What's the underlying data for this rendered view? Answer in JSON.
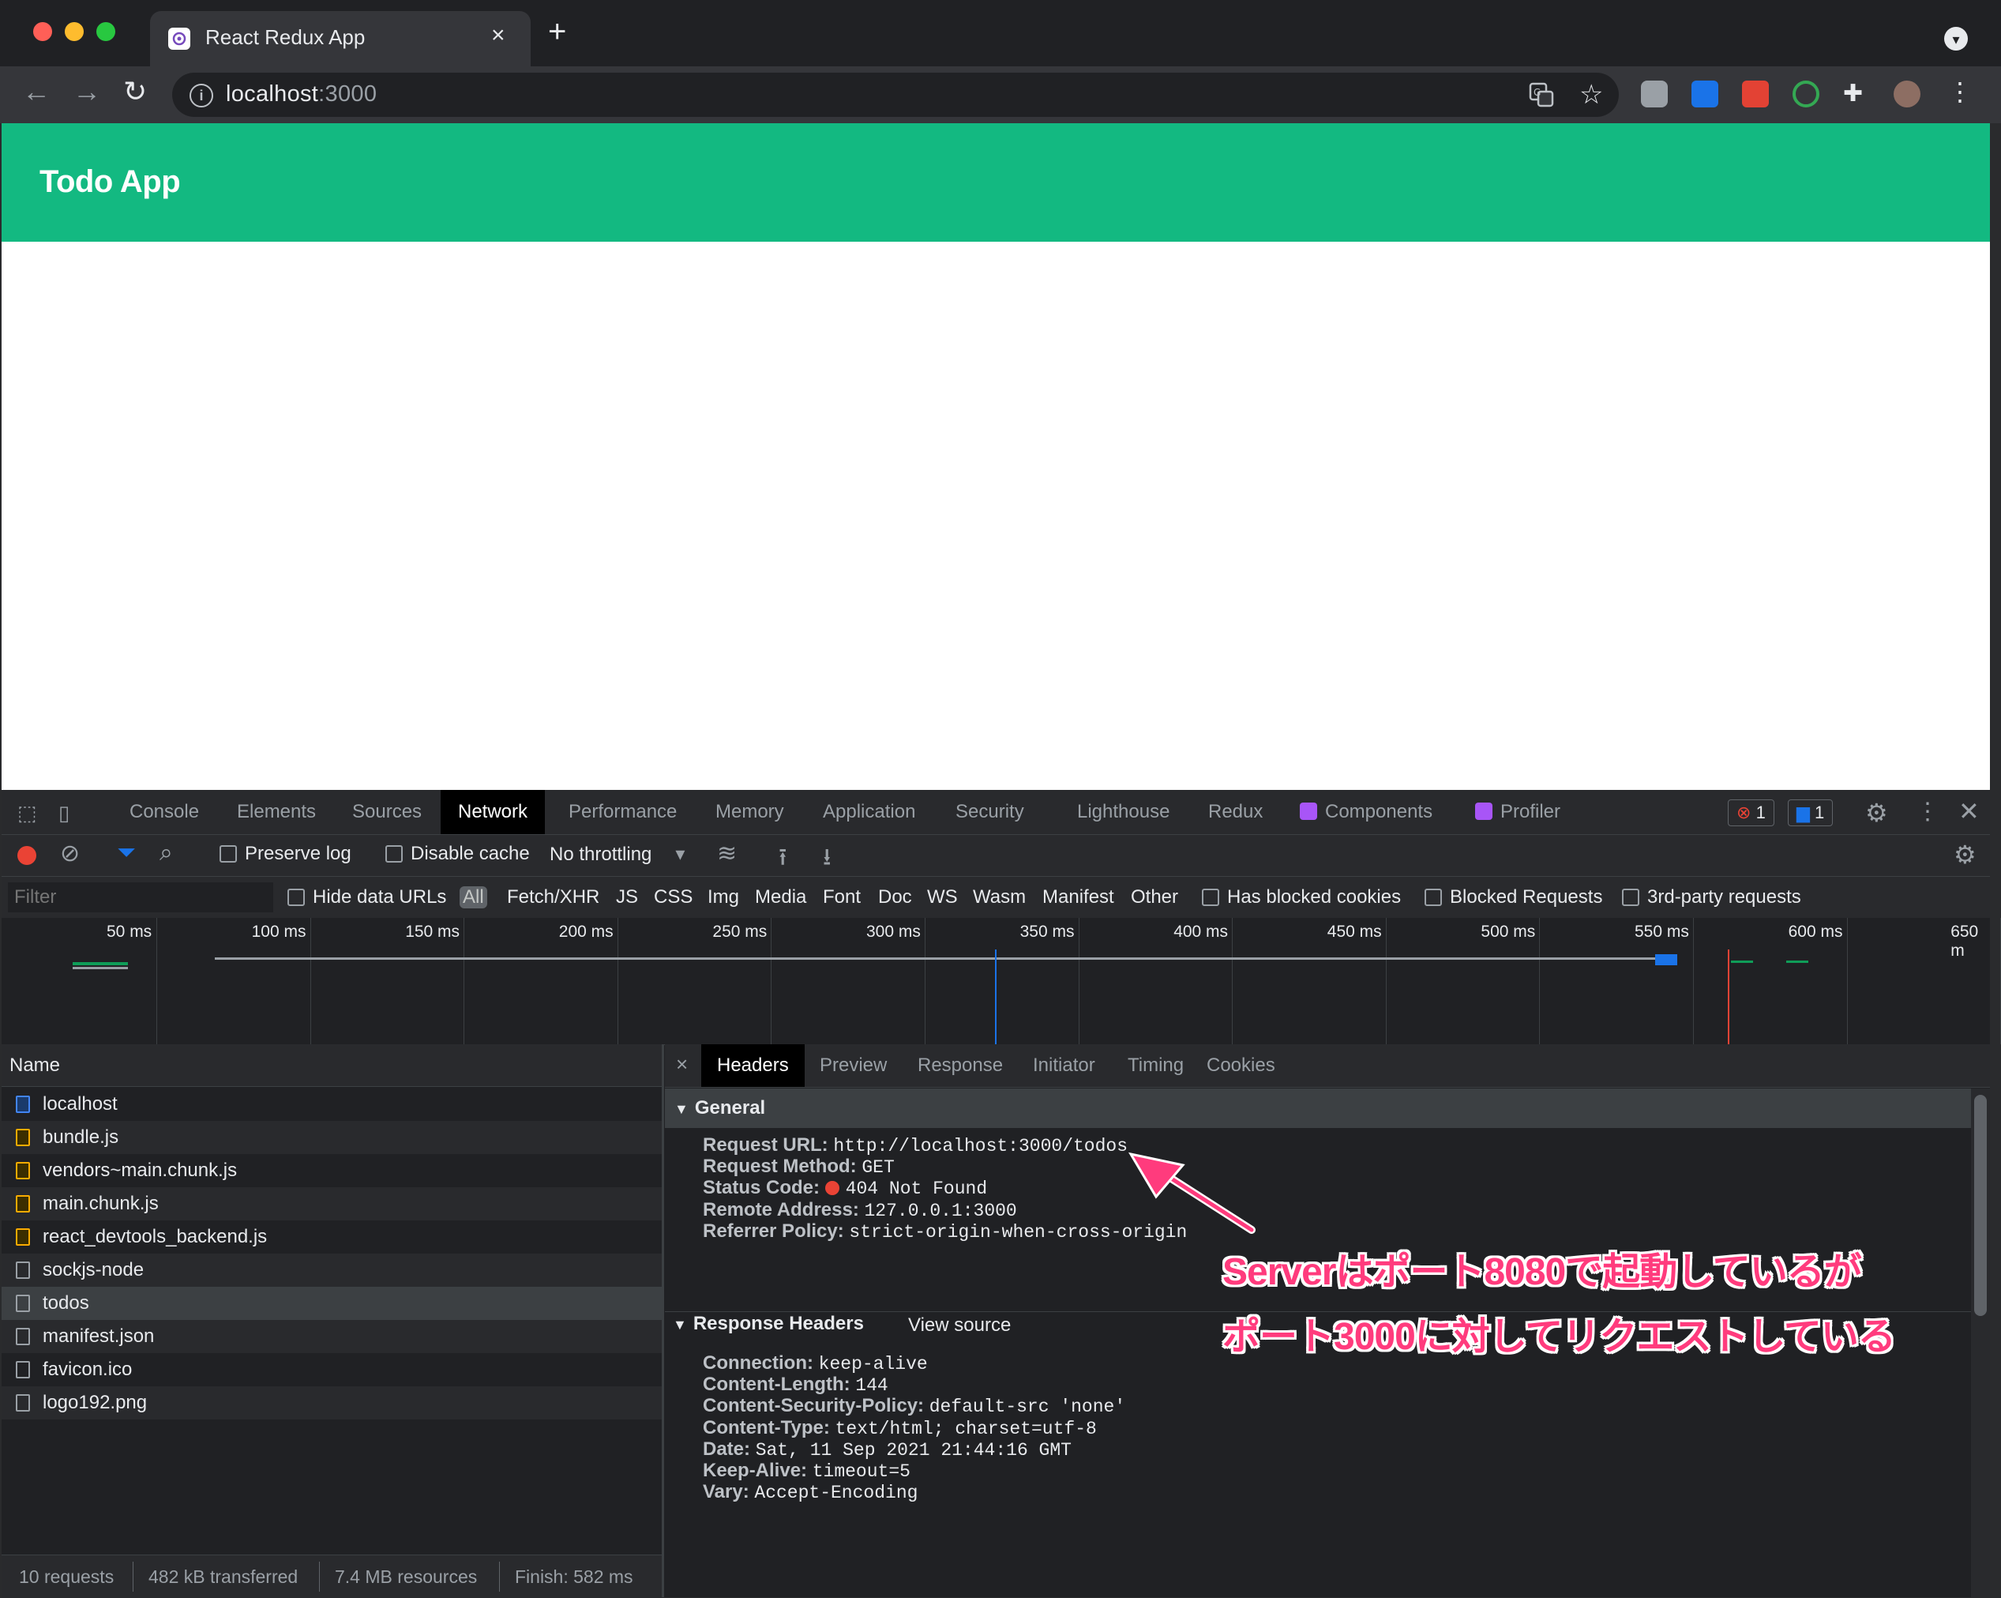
{
  "browser": {
    "tab_title": "React Redux App",
    "tab_close": "×",
    "new_tab": "+",
    "url_host": "localhost",
    "url_port": ":3000"
  },
  "app": {
    "title": "Todo App"
  },
  "devtools": {
    "tabs": [
      "Console",
      "Elements",
      "Sources",
      "Network",
      "Performance",
      "Memory",
      "Application",
      "Security",
      "Lighthouse",
      "Redux",
      "Components",
      "Profiler"
    ],
    "active_tab": "Network",
    "error_count": "1",
    "message_count": "1",
    "controls": {
      "preserve_log": "Preserve log",
      "disable_cache": "Disable cache",
      "throttling": "No throttling"
    },
    "filter": {
      "placeholder": "Filter",
      "hide_data_urls": "Hide data URLs",
      "types": [
        "All",
        "Fetch/XHR",
        "JS",
        "CSS",
        "Img",
        "Media",
        "Font",
        "Doc",
        "WS",
        "Wasm",
        "Manifest",
        "Other"
      ],
      "selected_type": "All",
      "has_blocked_cookies": "Has blocked cookies",
      "blocked_requests": "Blocked Requests",
      "third_party": "3rd-party requests"
    },
    "timeline_ticks": [
      "50 ms",
      "100 ms",
      "150 ms",
      "200 ms",
      "250 ms",
      "300 ms",
      "350 ms",
      "400 ms",
      "450 ms",
      "500 ms",
      "550 ms",
      "600 ms",
      "650 m"
    ],
    "name_header": "Name",
    "requests": [
      {
        "name": "localhost",
        "type": "doc",
        "color": "#4285f4"
      },
      {
        "name": "bundle.js",
        "type": "script",
        "color": "#f9ab00"
      },
      {
        "name": "vendors~main.chunk.js",
        "type": "script",
        "color": "#f9ab00"
      },
      {
        "name": "main.chunk.js",
        "type": "script",
        "color": "#f9ab00"
      },
      {
        "name": "react_devtools_backend.js",
        "type": "script",
        "color": "#f9ab00"
      },
      {
        "name": "sockjs-node",
        "type": "other",
        "color": "#9aa0a6"
      },
      {
        "name": "todos",
        "type": "other",
        "color": "#9aa0a6"
      },
      {
        "name": "manifest.json",
        "type": "other",
        "color": "#9aa0a6"
      },
      {
        "name": "favicon.ico",
        "type": "other",
        "color": "#9aa0a6"
      },
      {
        "name": "logo192.png",
        "type": "other",
        "color": "#9aa0a6"
      }
    ],
    "selected_request": "todos",
    "status": {
      "requests": "10 requests",
      "transferred": "482 kB transferred",
      "resources": "7.4 MB resources",
      "finish": "Finish: 582 ms"
    },
    "detail_tabs": [
      "Headers",
      "Preview",
      "Response",
      "Initiator",
      "Timing",
      "Cookies"
    ],
    "active_detail_tab": "Headers",
    "general": {
      "title": "General",
      "rows": [
        {
          "k": "Request URL:",
          "v": "http://localhost:3000/todos"
        },
        {
          "k": "Request Method:",
          "v": "GET"
        },
        {
          "k": "Status Code:",
          "v": "404 Not Found"
        },
        {
          "k": "Remote Address:",
          "v": "127.0.0.1:3000"
        },
        {
          "k": "Referrer Policy:",
          "v": "strict-origin-when-cross-origin"
        }
      ]
    },
    "response_headers": {
      "title": "Response Headers",
      "view_source": "View source",
      "rows": [
        {
          "k": "Connection:",
          "v": "keep-alive"
        },
        {
          "k": "Content-Length:",
          "v": "144"
        },
        {
          "k": "Content-Security-Policy:",
          "v": "default-src 'none'"
        },
        {
          "k": "Content-Type:",
          "v": "text/html; charset=utf-8"
        },
        {
          "k": "Date:",
          "v": "Sat, 11 Sep 2021 21:44:16 GMT"
        },
        {
          "k": "Keep-Alive:",
          "v": "timeout=5"
        },
        {
          "k": "Vary:",
          "v": "Accept-Encoding"
        }
      ]
    }
  },
  "annotation": {
    "line1": "Serverはポート8080で起動しているが",
    "line2": "ポート3000に対してリクエストしている",
    "color": "#ff3b7d"
  }
}
